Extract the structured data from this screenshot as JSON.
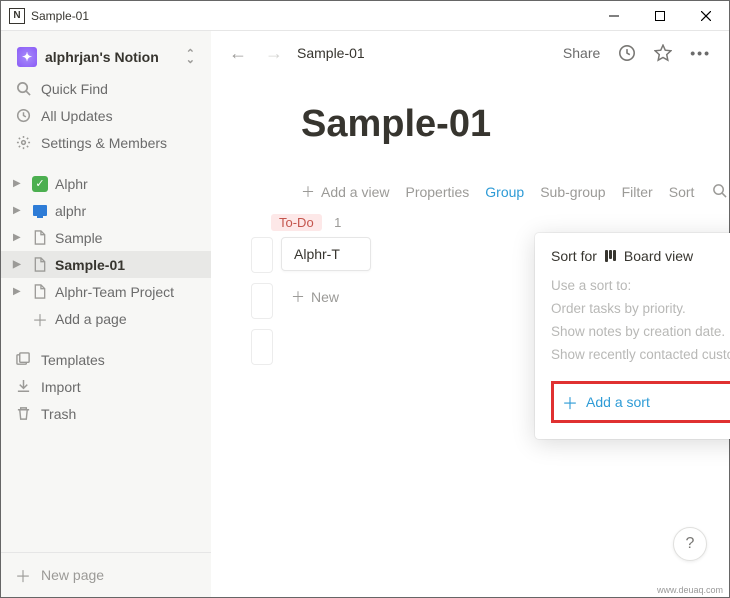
{
  "window": {
    "title": "Sample-01"
  },
  "workspace": {
    "name": "alphrjan's Notion"
  },
  "sidebar": {
    "quick_find": "Quick Find",
    "all_updates": "All Updates",
    "settings": "Settings & Members",
    "pages": [
      {
        "label": "Alphr",
        "icon": "green-check"
      },
      {
        "label": "alphr",
        "icon": "blue-monitor"
      },
      {
        "label": "Sample",
        "icon": "doc"
      },
      {
        "label": "Sample-01",
        "icon": "doc",
        "selected": true
      },
      {
        "label": "Alphr-Team Project",
        "icon": "doc"
      }
    ],
    "add_page": "Add a page",
    "templates": "Templates",
    "import": "Import",
    "trash": "Trash",
    "new_page": "New page"
  },
  "topbar": {
    "breadcrumb": "Sample-01",
    "share": "Share"
  },
  "page": {
    "title": "Sample-01"
  },
  "viewbar": {
    "add_view": "Add a view",
    "properties": "Properties",
    "group": "Group",
    "subgroup": "Sub-group",
    "filter": "Filter",
    "sort": "Sort"
  },
  "board": {
    "tag": "To-Do",
    "count": "1",
    "card1": "Alphr-T",
    "new": "New"
  },
  "popover": {
    "sort_for": "Sort for",
    "board_view": "Board view",
    "desc_intro": "Use a sort to:",
    "desc_l1": "Order tasks by priority.",
    "desc_l2": "Show notes by creation date.",
    "desc_l3": "Show recently contacted customers.",
    "add_sort": "Add a sort"
  },
  "watermark": "www.deuaq.com"
}
